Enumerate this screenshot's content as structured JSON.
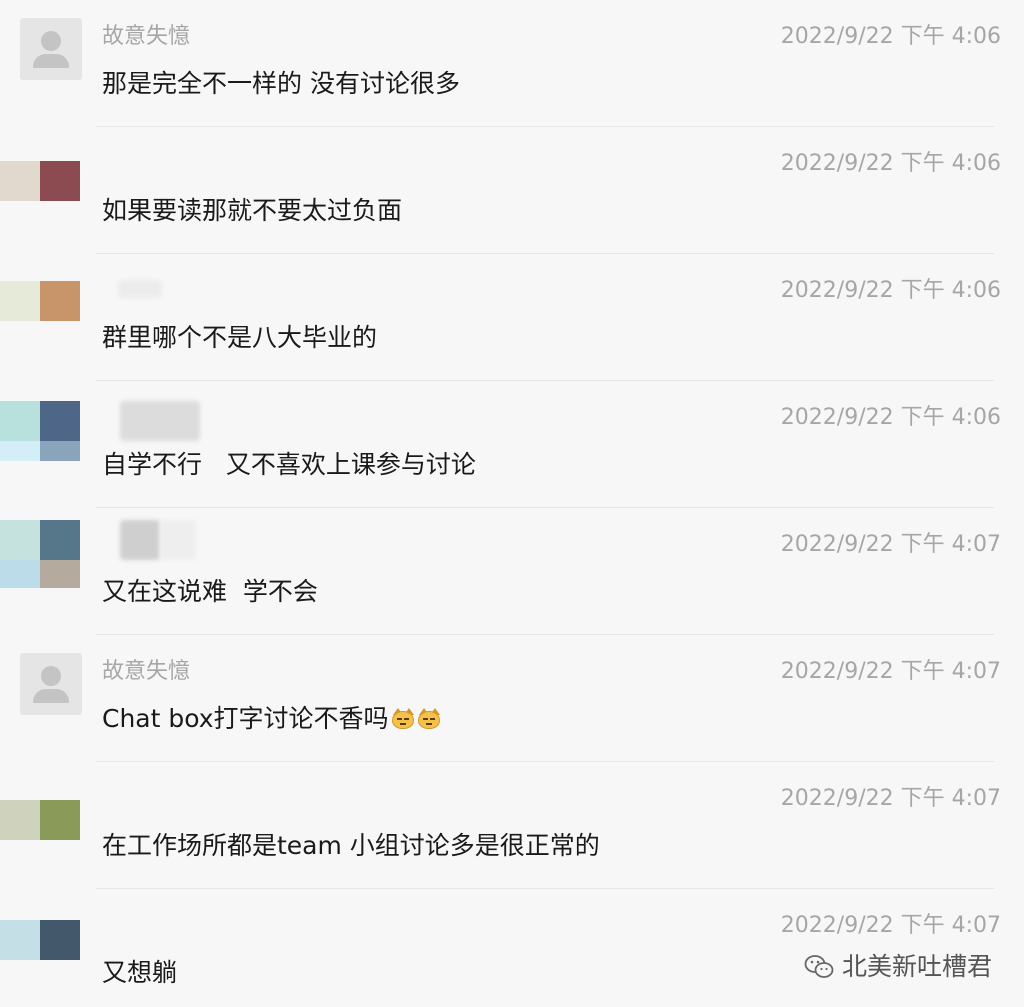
{
  "watermark": {
    "text": "北美新吐槽君",
    "icon": "wechat-icon"
  },
  "messages": [
    {
      "sender": "故意失憶",
      "time": "2022/9/22 下午 4:06",
      "text": "那是完全不一样的 没有讨论很多",
      "avatar": "default-avatar",
      "colors": []
    },
    {
      "sender": "",
      "time": "2022/9/22 下午 4:06",
      "text": "如果要读那就不要太过负面",
      "avatar": "mosaic-avatar",
      "colors": [
        "#e1d9cd",
        "#8c4b50",
        "#f2efea",
        "#f7f7f7"
      ]
    },
    {
      "sender": "",
      "time": "2022/9/22 下午 4:06",
      "text": "群里哪个不是八大毕业的",
      "avatar": "mosaic-avatar",
      "colors": [
        "#e6ead8",
        "#c8946a",
        "#f1f3ea",
        "#f7f7f7"
      ]
    },
    {
      "sender": "",
      "time": "2022/9/22 下午 4:06",
      "text": "自学不行   又不喜欢上课参与讨论",
      "avatar": "mosaic-avatar",
      "colors": [
        "#b8e0dc",
        "#4e6688",
        "#d3eef7",
        "#8aa4bb"
      ]
    },
    {
      "sender": "",
      "time": "2022/9/22 下午 4:07",
      "text": "又在这说难  学不会",
      "avatar": "mosaic-avatar",
      "colors": [
        "#c6e2df",
        "#56768a",
        "#bcdcea",
        "#b5aa9e"
      ]
    },
    {
      "sender": "故意失憶",
      "time": "2022/9/22 下午 4:07",
      "text": "Chat box打字讨论不香吗",
      "avatar": "default-avatar",
      "colors": [],
      "emojis": [
        "cat-face-emoji",
        "cat-face-emoji"
      ]
    },
    {
      "sender": "",
      "time": "2022/9/22 下午 4:07",
      "text": "在工作场所都是team 小组讨论多是很正常的",
      "avatar": "mosaic-avatar",
      "colors": [
        "#cfd2bc",
        "#8a9a58",
        "#f0f1ec",
        "#f7f7f7"
      ]
    },
    {
      "sender": "",
      "time": "2022/9/22 下午 4:07",
      "text": "又想躺",
      "avatar": "mosaic-avatar",
      "colors": [
        "#c4e0e6",
        "#43586a",
        "#eef5f6",
        "#f7f7f7"
      ]
    }
  ]
}
